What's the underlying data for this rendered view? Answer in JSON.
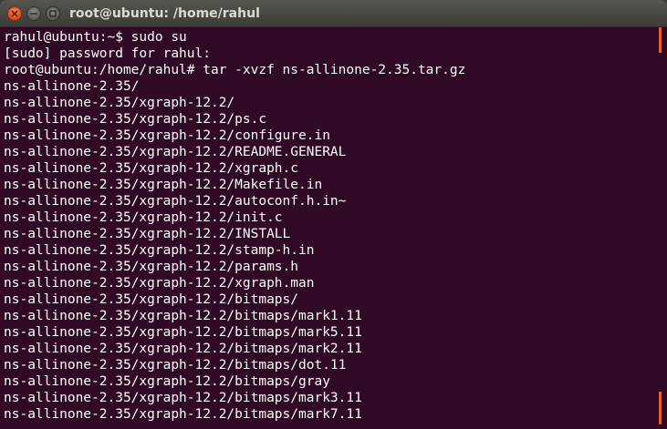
{
  "window": {
    "title": "root@ubuntu: /home/rahul"
  },
  "icons": {
    "close": "close-icon",
    "minimize": "minimize-icon",
    "maximize": "maximize-icon"
  },
  "colors": {
    "background": "#300a24",
    "text": "#ffffff",
    "accent": "#e8622c"
  },
  "terminal": {
    "lines": [
      "rahul@ubuntu:~$ sudo su",
      "[sudo] password for rahul:",
      "root@ubuntu:/home/rahul# tar -xvzf ns-allinone-2.35.tar.gz",
      "ns-allinone-2.35/",
      "ns-allinone-2.35/xgraph-12.2/",
      "ns-allinone-2.35/xgraph-12.2/ps.c",
      "ns-allinone-2.35/xgraph-12.2/configure.in",
      "ns-allinone-2.35/xgraph-12.2/README.GENERAL",
      "ns-allinone-2.35/xgraph-12.2/xgraph.c",
      "ns-allinone-2.35/xgraph-12.2/Makefile.in",
      "ns-allinone-2.35/xgraph-12.2/autoconf.h.in~",
      "ns-allinone-2.35/xgraph-12.2/init.c",
      "ns-allinone-2.35/xgraph-12.2/INSTALL",
      "ns-allinone-2.35/xgraph-12.2/stamp-h.in",
      "ns-allinone-2.35/xgraph-12.2/params.h",
      "ns-allinone-2.35/xgraph-12.2/xgraph.man",
      "ns-allinone-2.35/xgraph-12.2/bitmaps/",
      "ns-allinone-2.35/xgraph-12.2/bitmaps/mark1.11",
      "ns-allinone-2.35/xgraph-12.2/bitmaps/mark5.11",
      "ns-allinone-2.35/xgraph-12.2/bitmaps/mark2.11",
      "ns-allinone-2.35/xgraph-12.2/bitmaps/dot.11",
      "ns-allinone-2.35/xgraph-12.2/bitmaps/gray",
      "ns-allinone-2.35/xgraph-12.2/bitmaps/mark3.11",
      "ns-allinone-2.35/xgraph-12.2/bitmaps/mark7.11"
    ]
  }
}
